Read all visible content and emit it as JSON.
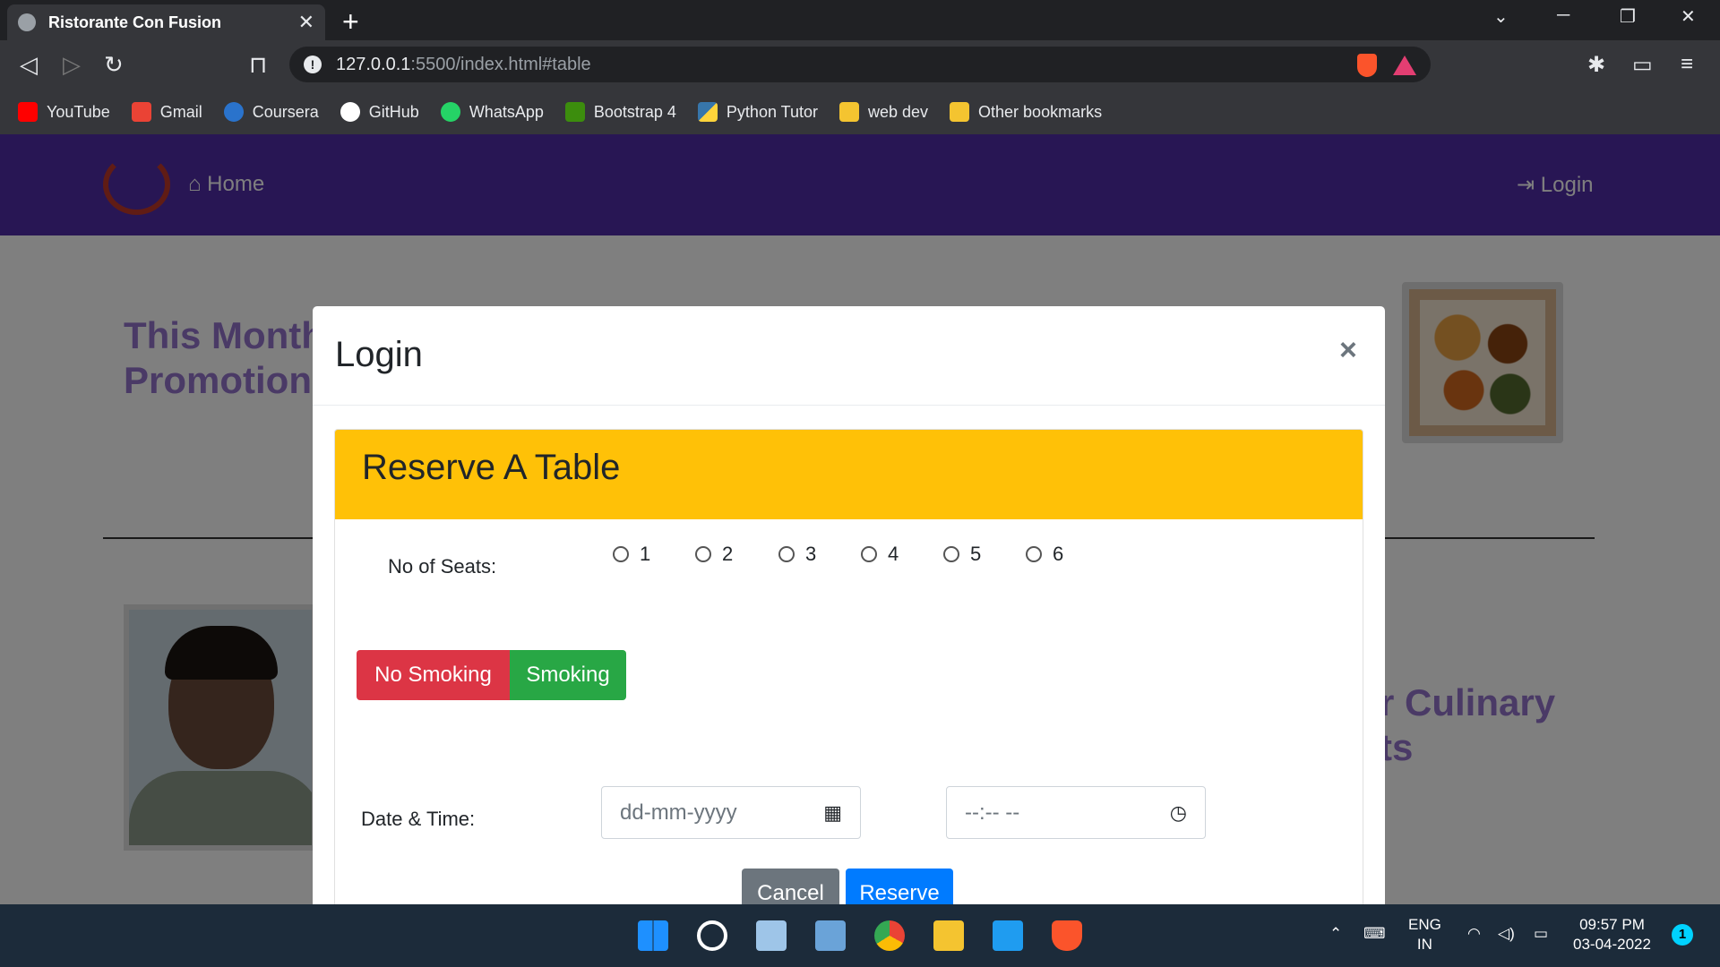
{
  "browser": {
    "tab_title": "Ristorante Con Fusion",
    "tab_close": "✕",
    "new_tab": "+",
    "url_host": "127.0.0.1",
    "url_rest": ":5500/index.html#table",
    "bookmarks": [
      {
        "label": "YouTube",
        "icon": "youtube-icon",
        "color": "#ff0000"
      },
      {
        "label": "Gmail",
        "icon": "gmail-icon",
        "color": "#ea4335"
      },
      {
        "label": "Coursera",
        "icon": "coursera-icon",
        "color": "#2a73cc"
      },
      {
        "label": "GitHub",
        "icon": "github-icon",
        "color": "#ffffff"
      },
      {
        "label": "WhatsApp",
        "icon": "whatsapp-icon",
        "color": "#25d366"
      },
      {
        "label": "Bootstrap 4",
        "icon": "bootstrap-icon",
        "color": "#3c8d0d"
      },
      {
        "label": "Python Tutor",
        "icon": "python-icon",
        "color": "#3776ab"
      },
      {
        "label": "web dev",
        "icon": "folder-icon",
        "color": "#f4c430"
      },
      {
        "label": "Other bookmarks",
        "icon": "folder-icon",
        "color": "#f4c430"
      }
    ]
  },
  "site": {
    "nav_home": "Home",
    "nav_login": "Login",
    "promo_line1": "This Month",
    "promo_line2": "Promotions",
    "culinary_line1": "r Culinary",
    "culinary_line2": "ts"
  },
  "modal": {
    "title": "Login",
    "close": "×",
    "card_title": "Reserve A Table",
    "seats_label": "No of Seats:",
    "seat_options": [
      "1",
      "2",
      "3",
      "4",
      "5",
      "6"
    ],
    "no_smoking": "No Smoking",
    "smoking": "Smoking",
    "datetime_label": "Date & Time:",
    "date_placeholder": "dd-mm-yyyy",
    "time_placeholder": "--:-- --",
    "cancel": "Cancel",
    "reserve": "Reserve"
  },
  "taskbar": {
    "lang_top": "ENG",
    "lang_bottom": "IN",
    "time": "09:57 PM",
    "date": "03-04-2022",
    "notifications": "1"
  }
}
